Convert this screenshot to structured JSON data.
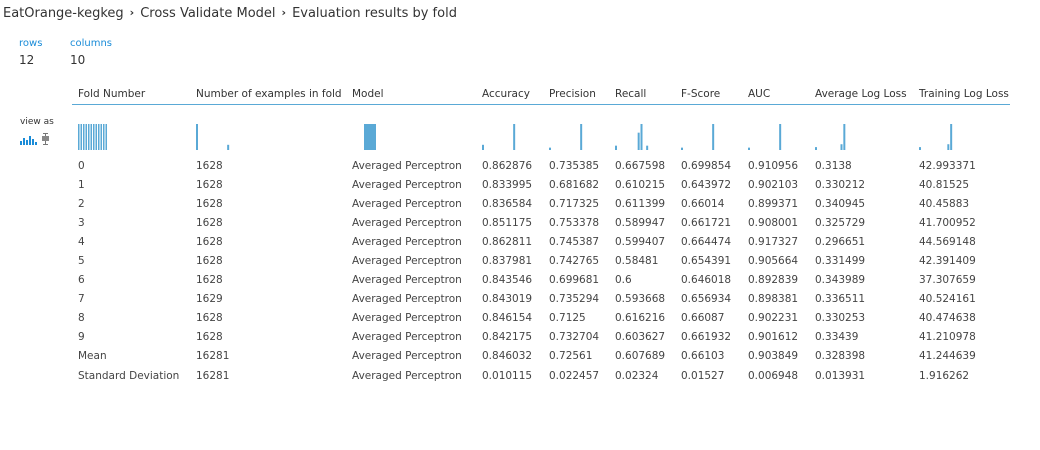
{
  "breadcrumb": {
    "items": [
      "EatOrange-kegkeg",
      "Cross Validate Model",
      "Evaluation results by fold"
    ],
    "separator": "›"
  },
  "stats": {
    "rows_label": "rows",
    "rows_value": "12",
    "columns_label": "columns",
    "columns_value": "10"
  },
  "view_as_label": "view as",
  "colors": {
    "accent": "#1a8cd8",
    "hist_bar": "#5aa9d6",
    "divider": "#5aa9d6"
  },
  "icons": {
    "histogram_view": "bar-chart-icon",
    "boxplot_view": "boxplot-icon"
  },
  "table": {
    "columns": [
      "Fold Number",
      "Number of examples in fold",
      "Model",
      "Accuracy",
      "Precision",
      "Recall",
      "F-Score",
      "AUC",
      "Average Log Loss",
      "Training Log Loss"
    ],
    "rows": [
      [
        "0",
        "1628",
        "Averaged Perceptron",
        "0.862876",
        "0.735385",
        "0.667598",
        "0.699854",
        "0.910956",
        "0.3138",
        "42.993371"
      ],
      [
        "1",
        "1628",
        "Averaged Perceptron",
        "0.833995",
        "0.681682",
        "0.610215",
        "0.643972",
        "0.902103",
        "0.330212",
        "40.81525"
      ],
      [
        "2",
        "1628",
        "Averaged Perceptron",
        "0.836584",
        "0.717325",
        "0.611399",
        "0.66014",
        "0.899371",
        "0.340945",
        "40.45883"
      ],
      [
        "3",
        "1628",
        "Averaged Perceptron",
        "0.851175",
        "0.753378",
        "0.589947",
        "0.661721",
        "0.908001",
        "0.325729",
        "41.700952"
      ],
      [
        "4",
        "1628",
        "Averaged Perceptron",
        "0.862811",
        "0.745387",
        "0.599407",
        "0.664474",
        "0.917327",
        "0.296651",
        "44.569148"
      ],
      [
        "5",
        "1628",
        "Averaged Perceptron",
        "0.837981",
        "0.742765",
        "0.58481",
        "0.654391",
        "0.905664",
        "0.331499",
        "42.391409"
      ],
      [
        "6",
        "1628",
        "Averaged Perceptron",
        "0.843546",
        "0.699681",
        "0.6",
        "0.646018",
        "0.892839",
        "0.343989",
        "37.307659"
      ],
      [
        "7",
        "1629",
        "Averaged Perceptron",
        "0.843019",
        "0.735294",
        "0.593668",
        "0.656934",
        "0.898381",
        "0.336511",
        "40.524161"
      ],
      [
        "8",
        "1628",
        "Averaged Perceptron",
        "0.846154",
        "0.7125",
        "0.616216",
        "0.66087",
        "0.902231",
        "0.330253",
        "40.474638"
      ],
      [
        "9",
        "1628",
        "Averaged Perceptron",
        "0.842175",
        "0.732704",
        "0.603627",
        "0.661932",
        "0.901612",
        "0.33439",
        "41.210978"
      ],
      [
        "Mean",
        "16281",
        "Averaged Perceptron",
        "0.846032",
        "0.72561",
        "0.607689",
        "0.66103",
        "0.903849",
        "0.328398",
        "41.244639"
      ],
      [
        "Standard Deviation",
        "16281",
        "Averaged Perceptron",
        "0.010115",
        "0.022457",
        "0.02324",
        "0.01527",
        "0.006948",
        "0.013931",
        "1.916262"
      ]
    ],
    "histograms": [
      [
        1,
        1,
        1,
        1,
        1,
        1,
        1,
        1,
        1,
        1,
        1,
        1
      ],
      [
        10,
        0,
        0,
        0,
        0,
        0,
        0,
        0,
        0,
        0,
        0,
        2
      ],
      [
        12
      ],
      [
        2,
        0,
        0,
        0,
        0,
        0,
        0,
        0,
        0,
        0,
        0,
        10
      ],
      [
        1,
        0,
        0,
        0,
        0,
        0,
        0,
        0,
        0,
        0,
        0,
        11
      ],
      [
        1,
        0,
        0,
        0,
        0,
        0,
        0,
        0,
        4,
        6,
        0,
        1
      ],
      [
        1,
        0,
        0,
        0,
        0,
        0,
        0,
        0,
        0,
        0,
        0,
        11
      ],
      [
        1,
        0,
        0,
        0,
        0,
        0,
        0,
        0,
        0,
        0,
        0,
        11
      ],
      [
        1,
        0,
        0,
        0,
        0,
        0,
        0,
        0,
        0,
        2,
        9,
        0
      ],
      [
        1,
        0,
        0,
        0,
        0,
        0,
        0,
        0,
        0,
        0,
        2,
        9
      ]
    ]
  }
}
